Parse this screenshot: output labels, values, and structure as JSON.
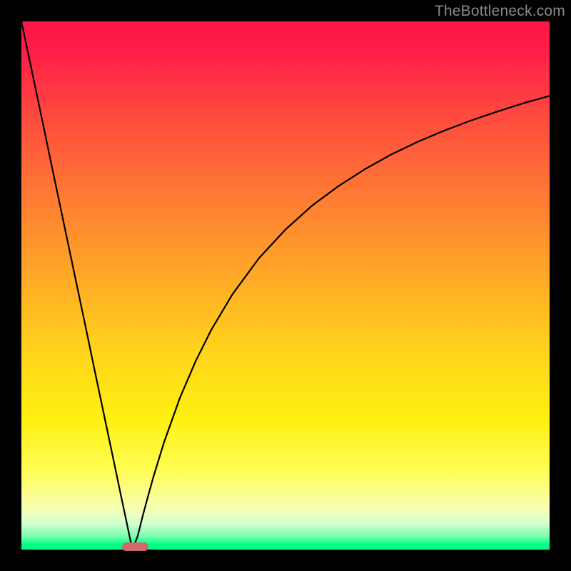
{
  "watermark": {
    "text": "TheBottleneck.com"
  },
  "colors": {
    "frame": "#000000",
    "curve_stroke": "#000000",
    "marker_fill": "#cf6a6a",
    "gradient_stops": [
      "#ff1447",
      "#ff4a3e",
      "#ff7a33",
      "#ffa827",
      "#ffd21c",
      "#fff010",
      "#fffd55",
      "#f7ffaf",
      "#d6ffcf",
      "#79ffb0",
      "#00ff88"
    ]
  },
  "chart_data": {
    "type": "line",
    "title": "",
    "xlabel": "",
    "ylabel": "",
    "xlim": [
      0,
      100
    ],
    "ylim": [
      0,
      100
    ],
    "grid": false,
    "legend": false,
    "optimum_x": 21,
    "marker": {
      "x_start": 19,
      "x_end": 24,
      "y": 0
    },
    "series": [
      {
        "name": "bottleneck-curve",
        "x": [
          0,
          2,
          4,
          6,
          8,
          10,
          12,
          14,
          16,
          18,
          19,
          20,
          21,
          22,
          23,
          24,
          25,
          27,
          30,
          33,
          36,
          40,
          45,
          50,
          55,
          60,
          65,
          70,
          75,
          80,
          85,
          90,
          95,
          100
        ],
        "y": [
          100,
          90.5,
          81,
          71.4,
          61.9,
          52.4,
          42.9,
          33.3,
          23.8,
          14.3,
          9.5,
          4.8,
          0,
          2.5,
          6.5,
          10.2,
          13.8,
          20.3,
          28.7,
          35.7,
          41.7,
          48.4,
          55.2,
          60.6,
          65.1,
          68.8,
          72.0,
          74.8,
          77.2,
          79.3,
          81.2,
          82.9,
          84.5,
          85.9
        ]
      }
    ]
  }
}
